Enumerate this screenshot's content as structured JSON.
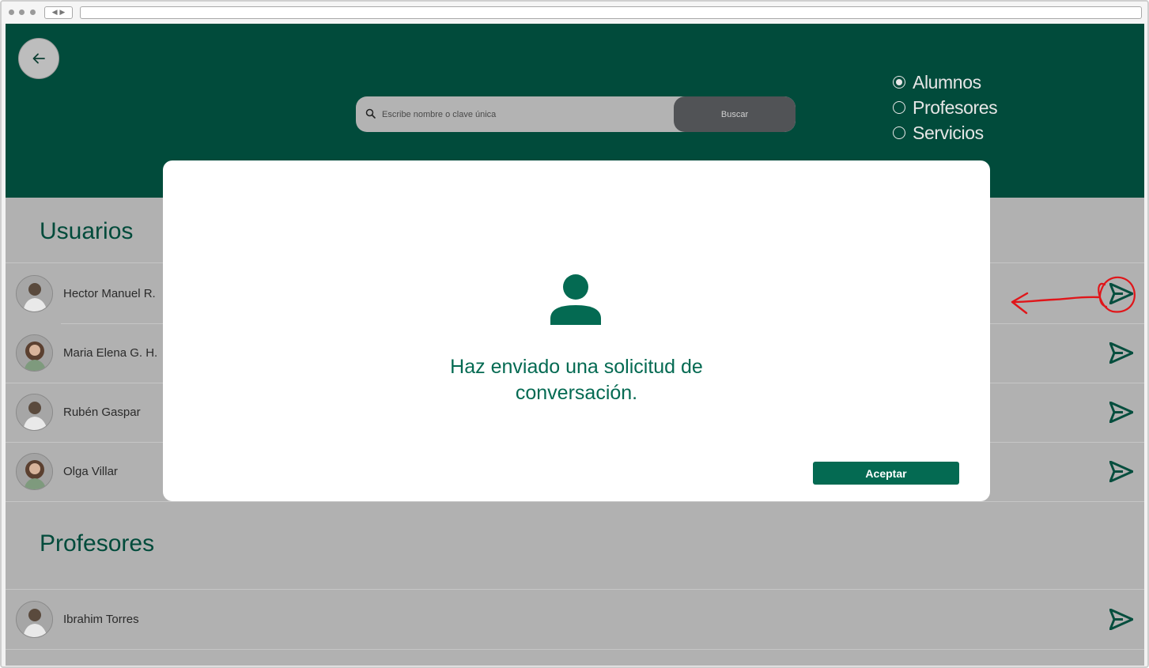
{
  "window": {
    "nav_glyph": "◀ ▶"
  },
  "header": {
    "search": {
      "placeholder": "Escribe nombre o clave única",
      "button_label": "Buscar"
    },
    "filters": [
      {
        "label": "Alumnos",
        "selected": true
      },
      {
        "label": "Profesores",
        "selected": false
      },
      {
        "label": "Servicios",
        "selected": false
      }
    ]
  },
  "sections": {
    "usuarios": {
      "title": "Usuarios",
      "users": [
        {
          "name": "Hector Manuel R."
        },
        {
          "name": "Maria Elena G. H."
        },
        {
          "name": "Rubén Gaspar"
        },
        {
          "name": "Olga Villar"
        }
      ]
    },
    "profesores": {
      "title": "Profesores",
      "users": [
        {
          "name": "Ibrahim Torres"
        }
      ]
    }
  },
  "modal": {
    "message": "Haz enviado una solicitud de conversación.",
    "accept_label": "Aceptar"
  },
  "colors": {
    "header_bg": "#014b3b",
    "accent": "#046a52",
    "overlay_bg": "#b1b1b1",
    "annotation": "#e0161a"
  },
  "icons": {
    "back": "arrow-left-icon",
    "search": "search-icon",
    "send": "send-icon",
    "user": "user-icon"
  }
}
